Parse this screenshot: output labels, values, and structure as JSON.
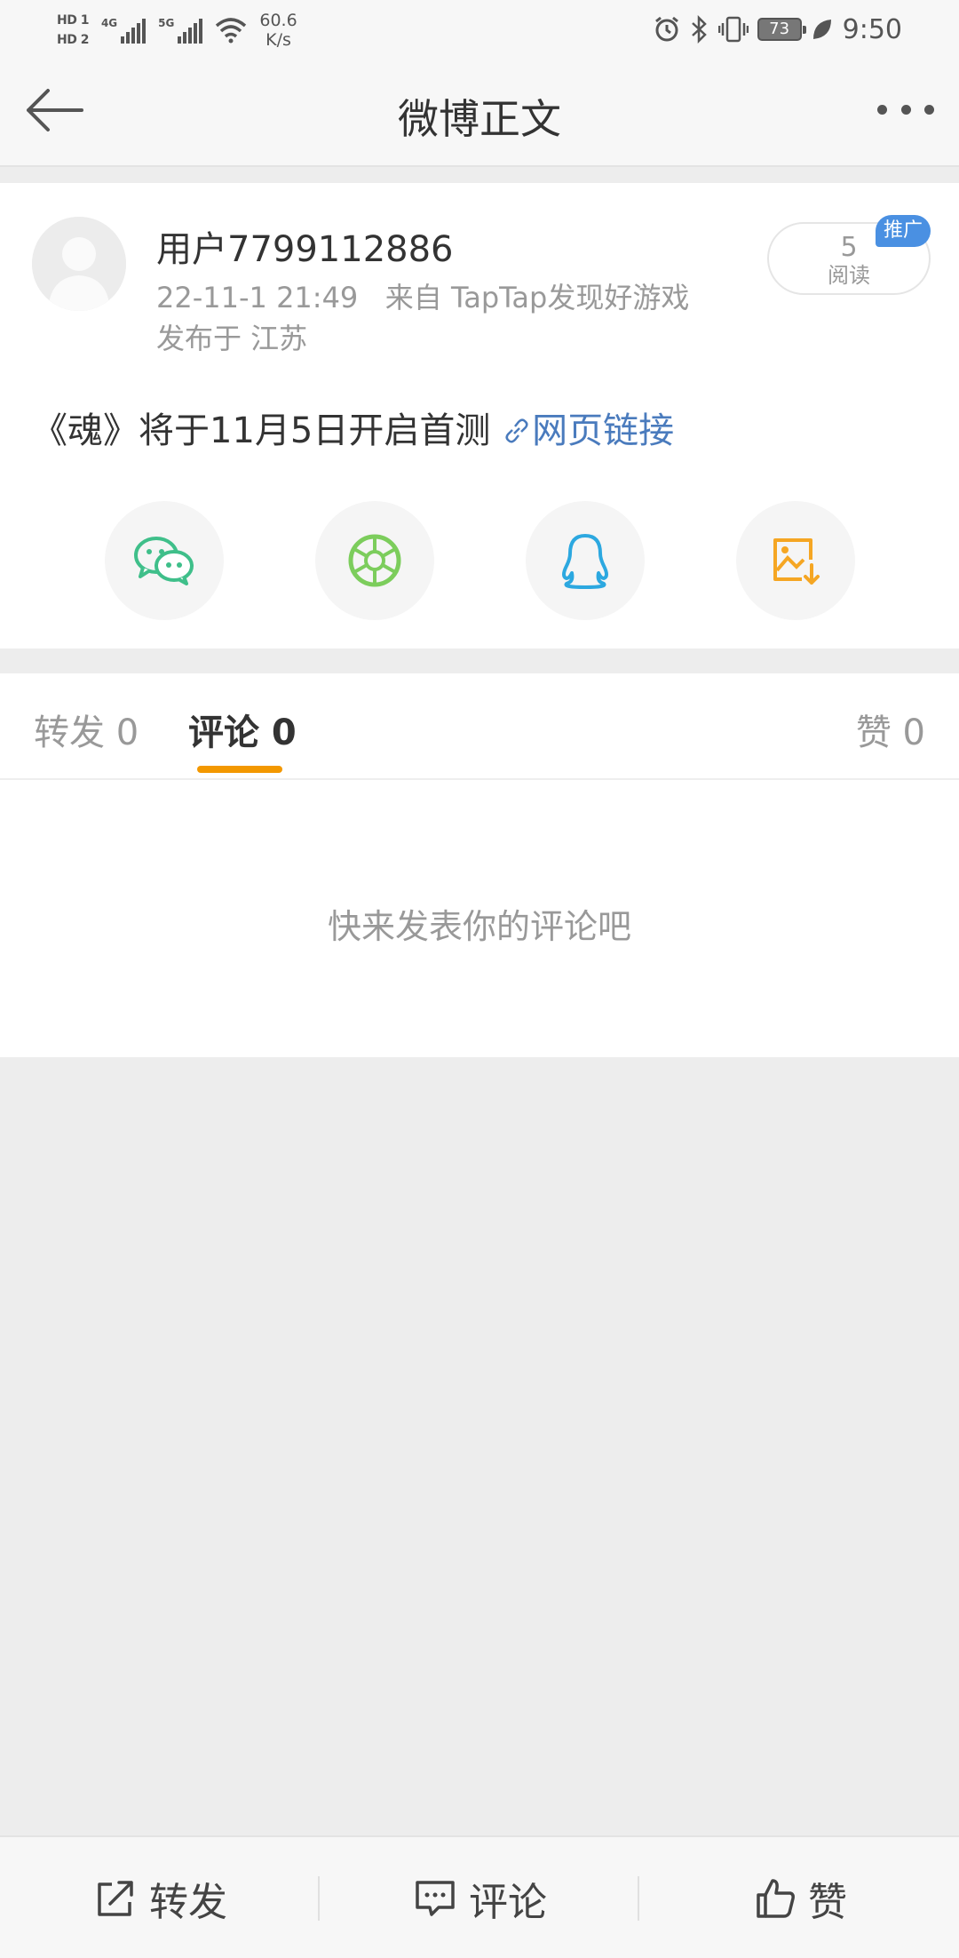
{
  "status_bar": {
    "sim1": "HD 1",
    "sim2": "HD 2",
    "net1": "4G",
    "net2": "5G",
    "speed_value": "60.6",
    "speed_unit": "K/s",
    "battery": "73",
    "time": "9:50"
  },
  "header": {
    "title": "微博正文"
  },
  "post": {
    "username": "用户7799112886",
    "timestamp": "22-11-1 21:49",
    "source": "来自 TapTap发现好游戏",
    "location": "发布于 江苏",
    "read_count": "5",
    "read_label": "阅读",
    "promo_tag": "推广",
    "text": "《魂》将于11月5日开启首测",
    "link_text": "网页链接"
  },
  "share": {
    "items": [
      "wechat-icon",
      "moments-icon",
      "qq-icon",
      "save-image-icon"
    ],
    "colors": {
      "wechat": "#3fbf8a",
      "moments": "#7ccd5c",
      "qq": "#2ca8e0",
      "save": "#f5a623"
    }
  },
  "tabs": {
    "repost": "转发 0",
    "comment": "评论 0",
    "like": "赞 0"
  },
  "comments": {
    "empty_text": "快来发表你的评论吧"
  },
  "bottom_bar": {
    "repost": "转发",
    "comment": "评论",
    "like": "赞"
  },
  "colors": {
    "accent": "#f39800",
    "link": "#4a7bbd",
    "promo": "#4a90e2"
  }
}
